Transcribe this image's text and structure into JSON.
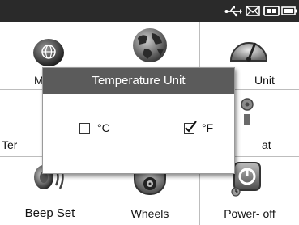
{
  "status_bar": {
    "icons": [
      "usb-icon",
      "mail-icon",
      "battery-pack-icon",
      "battery-icon"
    ]
  },
  "tiles": [
    {
      "icon": "language-globe-icon",
      "label": "M",
      "full_label_hint": ""
    },
    {
      "icon": "world-globe-icon",
      "label": ""
    },
    {
      "icon": "speedometer-unit-icon",
      "label": "Unit"
    },
    {
      "icon": "thermometer-icon",
      "label": "Ter"
    },
    {
      "icon": "blank-icon",
      "label": ""
    },
    {
      "icon": "repeat-icon",
      "label": "at"
    },
    {
      "icon": "beep-speaker-icon",
      "label": "Beep Set"
    },
    {
      "icon": "wheels-tire-icon",
      "label": "Wheels"
    },
    {
      "icon": "power-button-icon",
      "label": "Power- off"
    }
  ],
  "dialog": {
    "title": "Temperature Unit",
    "options": [
      {
        "label": "°C",
        "checked": false
      },
      {
        "label": "°F",
        "checked": true
      }
    ]
  },
  "colors": {
    "status_bar": "#2a2a2a",
    "dialog_title_bg": "#5b5b5b",
    "grid_line": "#bdbdbd"
  }
}
